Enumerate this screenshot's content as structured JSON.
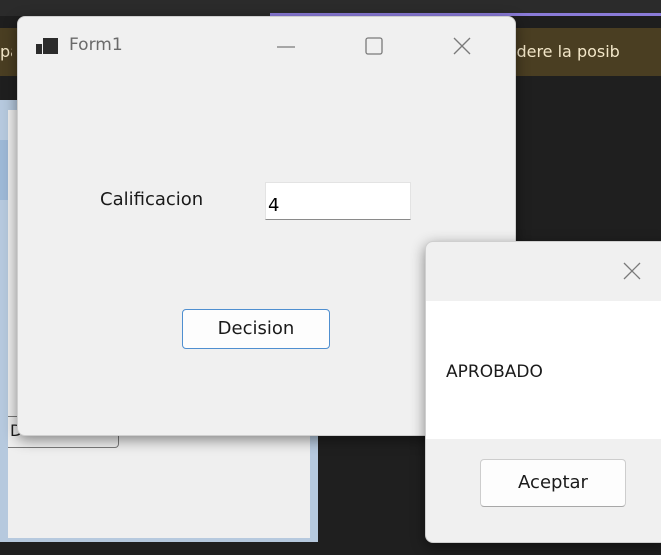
{
  "background": {
    "banner_right_text": "idere la posib",
    "banner_left_text": "pa",
    "designer_button_text": "D"
  },
  "form1": {
    "title": "Form1",
    "app_icon": "winforms-app-icon",
    "label_calificacion": "Calificacion",
    "input_value": "4",
    "decision_button": "Decision",
    "controls": [
      "minimize-icon",
      "maximize-icon",
      "close-icon"
    ]
  },
  "messagebox": {
    "message": "APROBADO",
    "ok_button": "Aceptar",
    "close_icon": "close-icon"
  },
  "colors": {
    "accent_border": "#4f8fd0",
    "banner_bg": "#4a3e22",
    "purple_accent": "#8a7bd8"
  }
}
